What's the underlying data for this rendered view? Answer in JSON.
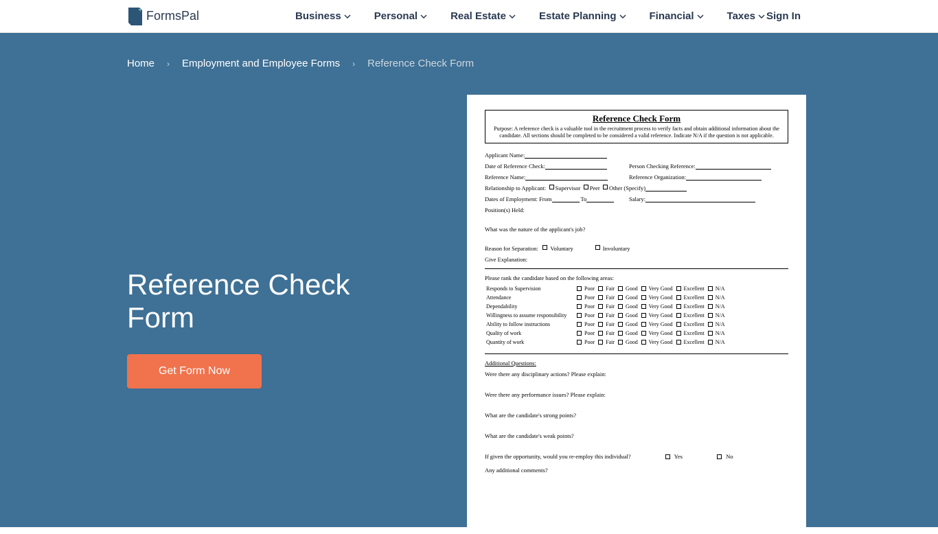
{
  "brand": "FormsPal",
  "nav": [
    "Business",
    "Personal",
    "Real Estate",
    "Estate Planning",
    "Financial",
    "Taxes"
  ],
  "signin": "Sign In",
  "breadcrumb": {
    "home": "Home",
    "cat": "Employment and Employee Forms",
    "current": "Reference Check Form"
  },
  "hero": {
    "title": "Reference Check Form",
    "cta": "Get Form Now"
  },
  "doc": {
    "title": "Reference Check Form",
    "purpose": "Purpose: A reference check is a valuable tool in the recruitment process to verify facts and obtain additional information about the candidate. All sections should be completed to be considered a valid reference. Indicate N/A if the question is not applicable.",
    "fields": {
      "applicant": "Applicant Name:",
      "date": "Date of Reference Check:",
      "person": "Person Checking Reference:",
      "refname": "Reference Name:",
      "reforg": "Reference Organization:",
      "rel": "Relationship to Applicant:",
      "rel_opts": [
        "Supervisor",
        "Peer",
        "Other (Specify)"
      ],
      "dates": "Dates of Employment:   From",
      "to": "To",
      "salary": "Salary:",
      "positions": "Position(s) Held:",
      "nature": "What was the nature of the applicant's job?",
      "reason": "Reason for Separation:",
      "reason_opts": [
        "Voluntary",
        "Involuntary"
      ],
      "explain": "Give Explanation:"
    },
    "rank_header": "Please rank the candidate based on the following areas:",
    "rank_rows": [
      "Responds to Supervision",
      "Attendance",
      "Dependability",
      "Willingness to assume responsibility",
      "Ability to follow instructions",
      "Quality of work",
      "Quantity of work"
    ],
    "rank_cols": [
      "Poor",
      "Fair",
      "Good",
      "Very Good",
      "Excellent",
      "N/A"
    ],
    "aq_title": "Additional Questions:",
    "aq": [
      "Were there any disciplinary actions?  Please explain:",
      "Were there any performance issues?  Please explain:",
      "What are the candidate's strong points?",
      "What are the candidate's weak points?"
    ],
    "reemploy": "If given the opportunity, would you re-employ this individual?",
    "yes": "Yes",
    "no": "No",
    "comments": "Any additional comments?"
  }
}
